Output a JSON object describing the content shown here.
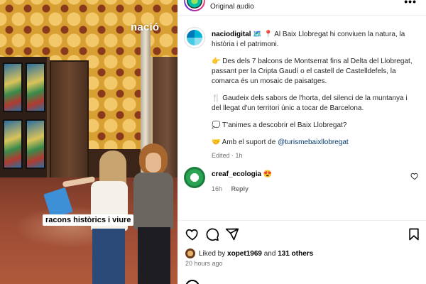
{
  "media": {
    "watermark": "nació",
    "caption": "racons històrics i viure"
  },
  "header": {
    "audio_label": "Original audio",
    "more_icon": "more-horizontal-icon"
  },
  "post": {
    "username": "naciodigital",
    "paragraphs": [
      "🗺️ 📍 Al Baix Llobregat hi conviuen la natura, la història i el patrimoni.",
      "👉 Des dels 7 balcons de Montserrat fins al Delta del Llobregat, passant per la Cripta Gaudí o el castell de Castelldefels, la comarca és un mosaic de paisatges.",
      "🍴 Gaudeix dels sabors de l'horta, del silenci de la muntanya i del llegat d'un territori únic a tocar de Barcelona.",
      "💭 T'animes a descobrir el Baix Llobregat?"
    ],
    "support_prefix": "🤝 Amb el suport de ",
    "mention": "@turismebaixllobregat",
    "edited_meta": "Edited · 1h"
  },
  "reply": {
    "username": "creaf_ecologia",
    "text": "😍",
    "time": "16h",
    "reply_label": "Reply"
  },
  "actions": {
    "icons": [
      "heart-icon",
      "comment-icon",
      "share-icon",
      "bookmark-icon"
    ]
  },
  "likes": {
    "prefix": "Liked by ",
    "user": "xopet1969",
    "middle": " and ",
    "count_text": "131 others"
  },
  "timestamp": "20 hours ago",
  "colors": {
    "text": "#262626",
    "muted": "#737373",
    "mention": "#00376b",
    "wall": "#d8a032"
  }
}
